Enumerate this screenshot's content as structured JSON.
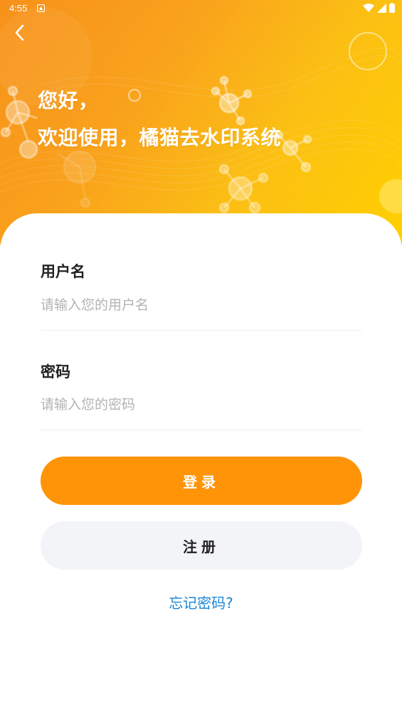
{
  "status_bar": {
    "time": "4:55"
  },
  "header": {
    "back_icon": "chevron-left-icon",
    "greeting_line1": "您好，",
    "greeting_line2": "欢迎使用，橘猫去水印系统"
  },
  "form": {
    "username": {
      "label": "用户名",
      "placeholder": "请输入您的用户名",
      "value": ""
    },
    "password": {
      "label": "密码",
      "placeholder": "请输入您的密码",
      "value": ""
    }
  },
  "actions": {
    "login_label": "登录",
    "register_label": "注册",
    "forgot_label": "忘记密码?"
  },
  "colors": {
    "accent": "#ff9408",
    "link": "#1a86d6",
    "secondary_button": "#f3f4f8"
  }
}
